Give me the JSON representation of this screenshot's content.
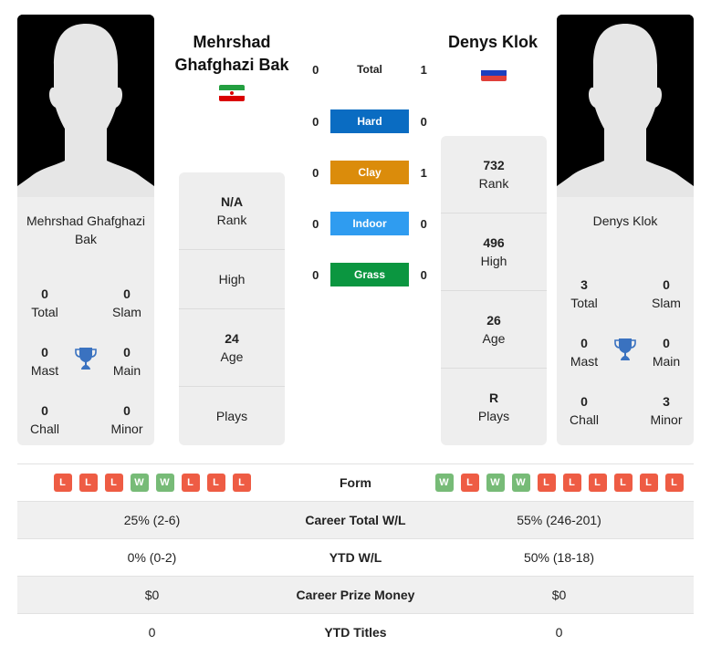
{
  "players": {
    "left": {
      "name_title": "Mehrshad Ghafghazi Bak",
      "name_title_lines": [
        "Mehrshad",
        "Ghafghazi Bak"
      ],
      "card_name": "Mehrshad Ghafghazi Bak",
      "flag": {
        "country": "Iran",
        "stripes": [
          "#239f40",
          "#ffffff",
          "#da0000"
        ]
      },
      "titles": {
        "total": {
          "value": "0",
          "label": "Total"
        },
        "slam": {
          "value": "0",
          "label": "Slam"
        },
        "mast": {
          "value": "0",
          "label": "Mast"
        },
        "main": {
          "value": "0",
          "label": "Main"
        },
        "chall": {
          "value": "0",
          "label": "Chall"
        },
        "minor": {
          "value": "0",
          "label": "Minor"
        }
      },
      "stats": {
        "rank": {
          "value": "N/A",
          "label": "Rank"
        },
        "high": {
          "value": "",
          "label": "High"
        },
        "age": {
          "value": "24",
          "label": "Age"
        },
        "plays": {
          "value": "",
          "label": "Plays"
        }
      },
      "form": [
        "L",
        "L",
        "L",
        "W",
        "W",
        "L",
        "L",
        "L"
      ]
    },
    "right": {
      "name_title": "Denys Klok",
      "card_name": "Denys Klok",
      "flag": {
        "country": "Russia",
        "stripes": [
          "#ffffff",
          "#1c3fbe",
          "#e0403a"
        ]
      },
      "titles": {
        "total": {
          "value": "3",
          "label": "Total"
        },
        "slam": {
          "value": "0",
          "label": "Slam"
        },
        "mast": {
          "value": "0",
          "label": "Mast"
        },
        "main": {
          "value": "0",
          "label": "Main"
        },
        "chall": {
          "value": "0",
          "label": "Chall"
        },
        "minor": {
          "value": "3",
          "label": "Minor"
        }
      },
      "stats": {
        "rank": {
          "value": "732",
          "label": "Rank"
        },
        "high": {
          "value": "496",
          "label": "High"
        },
        "age": {
          "value": "26",
          "label": "Age"
        },
        "plays": {
          "value": "R",
          "label": "Plays"
        }
      },
      "form": [
        "W",
        "L",
        "W",
        "W",
        "L",
        "L",
        "L",
        "L",
        "L",
        "L"
      ]
    }
  },
  "h2h": [
    {
      "label": "Total",
      "left": "0",
      "right": "1",
      "color": ""
    },
    {
      "label": "Hard",
      "left": "0",
      "right": "0",
      "color": "#0a6cc2"
    },
    {
      "label": "Clay",
      "left": "0",
      "right": "1",
      "color": "#db8c0b"
    },
    {
      "label": "Indoor",
      "left": "0",
      "right": "0",
      "color": "#2f9cf0"
    },
    {
      "label": "Grass",
      "left": "0",
      "right": "0",
      "color": "#0b9640"
    }
  ],
  "comparison": {
    "form_label": "Form",
    "rows": [
      {
        "label": "Career Total W/L",
        "left": "25% (2-6)",
        "right": "55% (246-201)"
      },
      {
        "label": "YTD W/L",
        "left": "0% (0-2)",
        "right": "50% (18-18)"
      },
      {
        "label": "Career Prize Money",
        "left": "$0",
        "right": "$0"
      },
      {
        "label": "YTD Titles",
        "left": "0",
        "right": "0"
      }
    ]
  },
  "icons": {
    "trophy": "trophy-icon",
    "silhouette": "player-silhouette-icon"
  },
  "colors": {
    "win": "#77bb77",
    "loss": "#ee5c44",
    "trophy": "#3a72c0",
    "card_bg": "#eeeeee"
  }
}
